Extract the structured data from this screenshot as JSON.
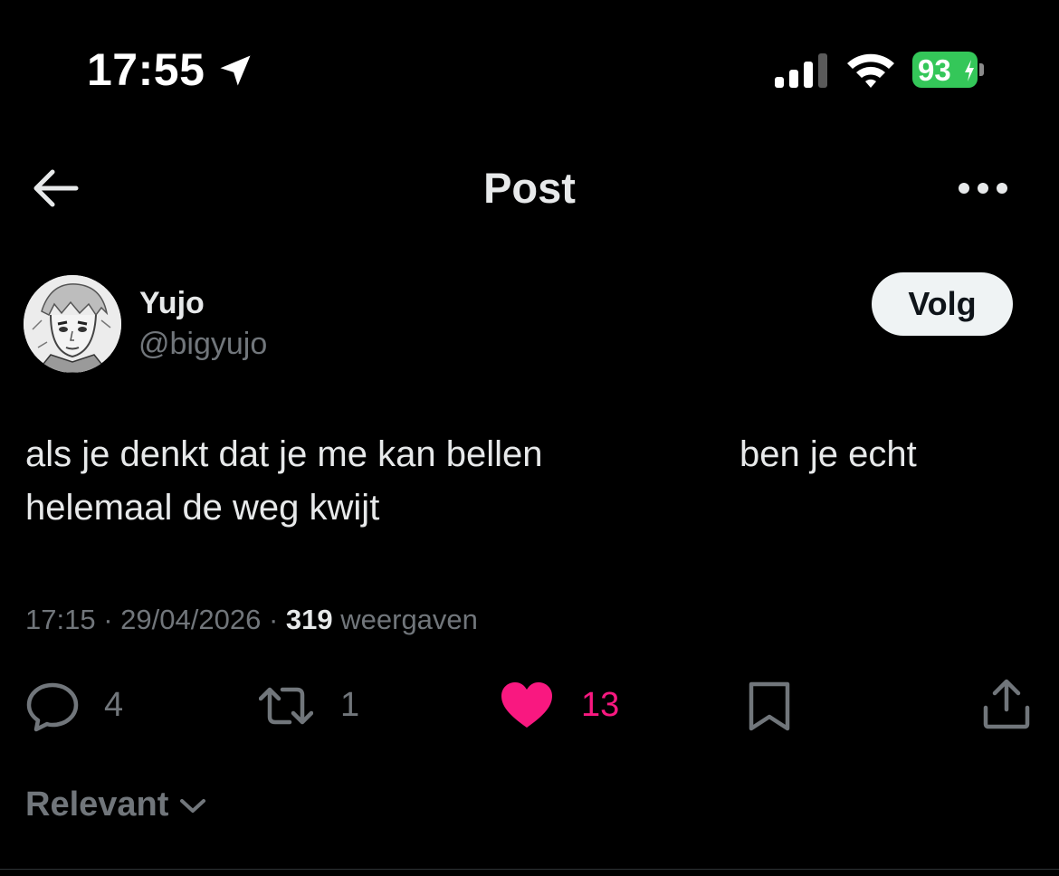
{
  "status_bar": {
    "time": "17:55",
    "battery": "93",
    "icons": [
      "location-arrow-icon",
      "signal-icon",
      "wifi-icon",
      "battery-icon"
    ],
    "battery_color": "#34c759"
  },
  "header": {
    "title": "Post",
    "back_icon": "arrow-left-icon",
    "more_icon": "more-dots-icon"
  },
  "author": {
    "name": "Yujo",
    "handle": "@bigyujo",
    "follow_label": "Volg"
  },
  "post": {
    "line1_left": "als je denkt dat je me kan bellen",
    "line1_right": "ben je echt",
    "line2": "helemaal de weg kwijt"
  },
  "meta": {
    "time": "17:15",
    "separator": "·",
    "date": "29/04/2026",
    "views_count": "319",
    "views_label": "weergaven"
  },
  "actions": {
    "replies": "4",
    "reposts": "1",
    "likes": "13",
    "like_color": "#f91880"
  },
  "sort": {
    "label": "Relevant"
  }
}
